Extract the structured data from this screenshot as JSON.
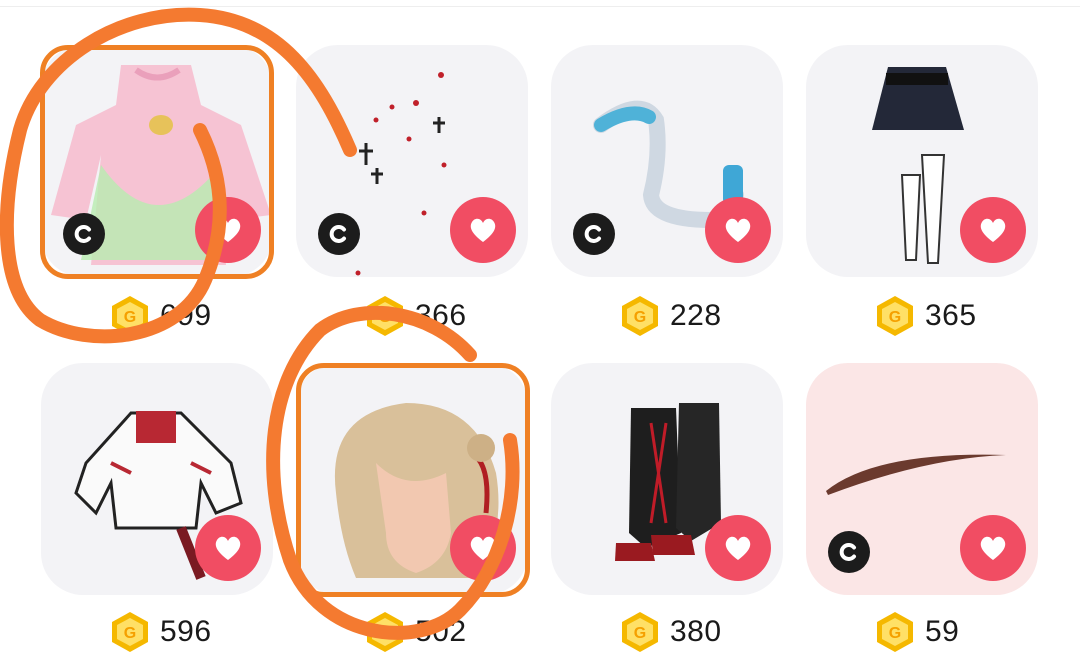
{
  "items": [
    {
      "name": "pink-green-dress",
      "price": "699",
      "creator_badge": "C",
      "liked_icon": "heart-icon"
    },
    {
      "name": "cross-and-drops-accessory",
      "price": "366",
      "creator_badge": "C",
      "liked_icon": "heart-icon"
    },
    {
      "name": "blue-white-tail",
      "price": "228",
      "creator_badge": "C",
      "liked_icon": "heart-icon"
    },
    {
      "name": "black-skirt-white-stockings",
      "price": "365",
      "creator_badge": "",
      "liked_icon": "heart-icon"
    },
    {
      "name": "white-red-jacket",
      "price": "596",
      "creator_badge": "",
      "liked_icon": "heart-icon"
    },
    {
      "name": "blonde-hair-red-ribbon",
      "price": "502",
      "creator_badge": "",
      "liked_icon": "heart-icon"
    },
    {
      "name": "black-laced-boots",
      "price": "380",
      "creator_badge": "",
      "liked_icon": "heart-icon"
    },
    {
      "name": "brown-eyebrow",
      "price": "59",
      "creator_badge": "C",
      "liked_icon": "heart-icon"
    }
  ],
  "colors": {
    "heart_button": "#f14d63",
    "coin": "#f5b800",
    "selection_frame": "#ef8024",
    "scribble": "#f47a30",
    "card_bg": "#f3f3f6"
  },
  "icons": {
    "currency": "g-coin-icon",
    "creator": "c-badge-icon",
    "like": "heart-icon"
  }
}
